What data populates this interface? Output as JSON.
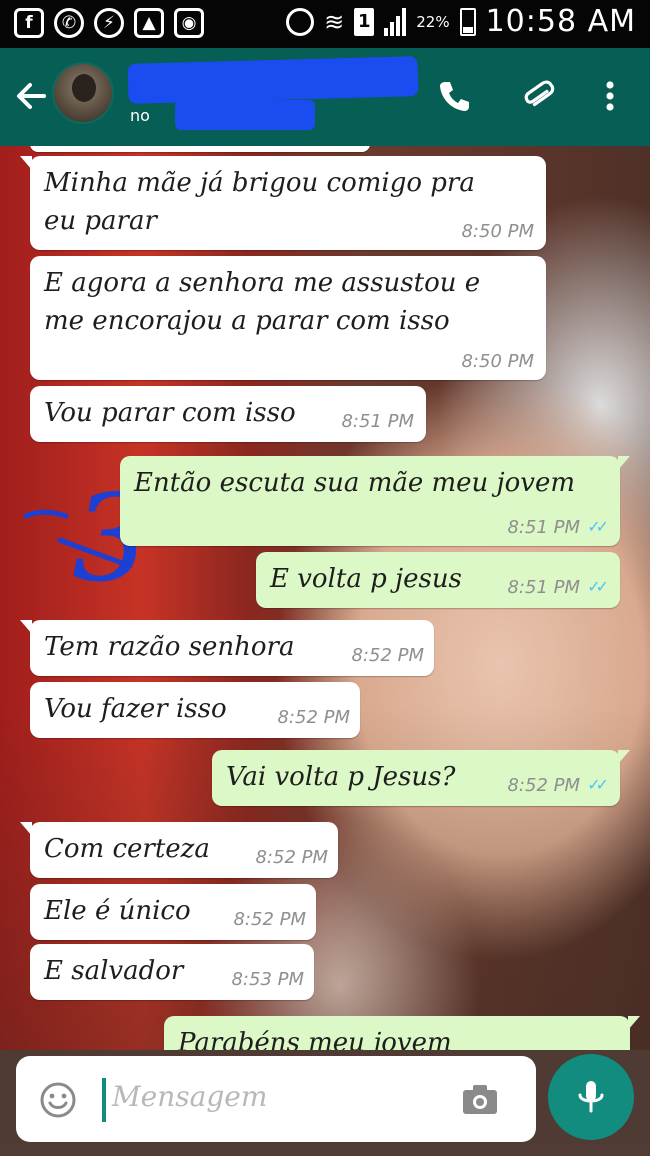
{
  "status_bar": {
    "notifications": [
      "f",
      "whatsapp",
      "messenger",
      "gallery",
      "instagram"
    ],
    "sim": "1",
    "battery": "22%",
    "time": "10:58 AM"
  },
  "header": {
    "contact_name": "",
    "contact_status": "no",
    "icons": [
      "back-arrow-icon",
      "phone-icon",
      "paperclip-icon",
      "more-vert-icon"
    ]
  },
  "annotation": "3",
  "messages": [
    {
      "dir": "in",
      "lines": [
        "Minha mãe já brigou comigo pra",
        "eu parar"
      ],
      "time": "8:50 PM"
    },
    {
      "dir": "in",
      "lines": [
        "E agora a senhora me assustou e",
        "me encorajou a parar com isso"
      ],
      "time": "8:50 PM"
    },
    {
      "dir": "in",
      "lines": [
        "Vou parar com isso"
      ],
      "time": "8:51 PM"
    },
    {
      "dir": "out",
      "lines": [
        "Então escuta sua mãe meu jovem"
      ],
      "time": "8:51 PM"
    },
    {
      "dir": "out",
      "lines": [
        "E volta p jesus"
      ],
      "time": "8:51 PM"
    },
    {
      "dir": "in",
      "lines": [
        "Tem razão senhora"
      ],
      "time": "8:52 PM"
    },
    {
      "dir": "in",
      "lines": [
        "Vou fazer isso"
      ],
      "time": "8:52 PM"
    },
    {
      "dir": "out",
      "lines": [
        "Vai volta p Jesus?"
      ],
      "time": "8:52 PM"
    },
    {
      "dir": "in",
      "lines": [
        "Com certeza"
      ],
      "time": "8:52 PM"
    },
    {
      "dir": "in",
      "lines": [
        "Ele é único"
      ],
      "time": "8:52 PM"
    },
    {
      "dir": "in",
      "lines": [
        "E salvador"
      ],
      "time": "8:53 PM"
    },
    {
      "dir": "out",
      "lines": [
        "Parabéns meu jovem"
      ],
      "time": ""
    }
  ],
  "input": {
    "placeholder": "Mensagem"
  },
  "colors": {
    "header": "#075e54",
    "outgoing": "#dcf8c6",
    "incoming": "#ffffff",
    "accent": "#128c7e",
    "read_ticks": "#4fc3f7"
  }
}
